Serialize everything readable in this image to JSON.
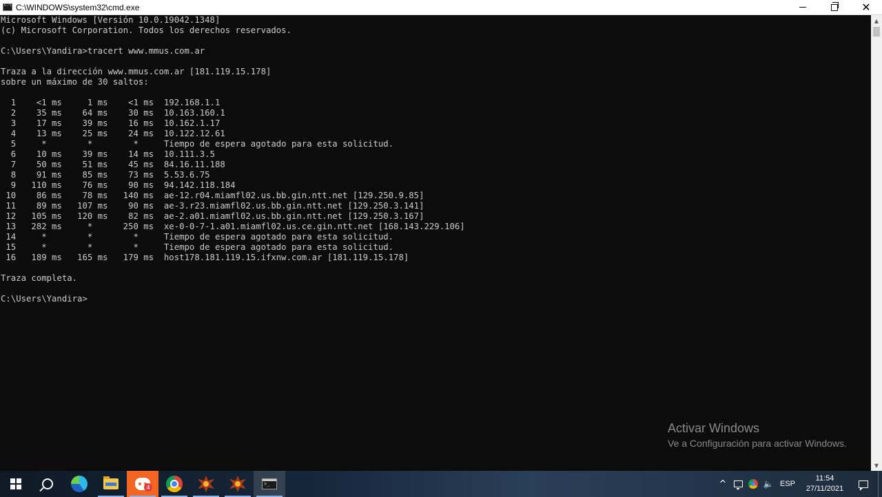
{
  "window": {
    "title": "C:\\WINDOWS\\system32\\cmd.exe",
    "icon": "cmd-icon"
  },
  "console": {
    "lines": [
      "Microsoft Windows [Versión 10.0.19042.1348]",
      "(c) Microsoft Corporation. Todos los derechos reservados.",
      "",
      "C:\\Users\\Yandira>tracert www.mmus.com.ar",
      "",
      "Traza a la dirección www.mmus.com.ar [181.119.15.178]",
      "sobre un máximo de 30 saltos:",
      "",
      "  1    <1 ms     1 ms    <1 ms  192.168.1.1",
      "  2    35 ms    64 ms    30 ms  10.163.160.1",
      "  3    17 ms    39 ms    16 ms  10.162.1.17",
      "  4    13 ms    25 ms    24 ms  10.122.12.61",
      "  5     *        *        *     Tiempo de espera agotado para esta solicitud.",
      "  6    10 ms    39 ms    14 ms  10.111.3.5",
      "  7    50 ms    51 ms    45 ms  84.16.11.188",
      "  8    91 ms    85 ms    73 ms  5.53.6.75",
      "  9   110 ms    76 ms    90 ms  94.142.118.184",
      " 10    86 ms    78 ms   140 ms  ae-12.r04.miamfl02.us.bb.gin.ntt.net [129.250.9.85]",
      " 11    89 ms   107 ms    90 ms  ae-3.r23.miamfl02.us.bb.gin.ntt.net [129.250.3.141]",
      " 12   105 ms   120 ms    82 ms  ae-2.a01.miamfl02.us.bb.gin.ntt.net [129.250.3.167]",
      " 13   282 ms     *      250 ms  xe-0-0-7-1.a01.miamfl02.us.ce.gin.ntt.net [168.143.229.106]",
      " 14     *        *        *     Tiempo de espera agotado para esta solicitud.",
      " 15     *        *        *     Tiempo de espera agotado para esta solicitud.",
      " 16   189 ms   165 ms   179 ms  host178.181.119.15.ifxnw.com.ar [181.119.15.178]",
      "",
      "Traza completa.",
      "",
      "C:\\Users\\Yandira>"
    ]
  },
  "watermark": {
    "title": "Activar Windows",
    "subtitle": "Ve a Configuración para activar Windows."
  },
  "taskbar": {
    "apps": [
      {
        "name": "start",
        "icon": "windows-logo-icon"
      },
      {
        "name": "search",
        "icon": "search-icon"
      },
      {
        "name": "edge",
        "icon": "edge-icon"
      },
      {
        "name": "file-explorer",
        "icon": "folder-icon"
      },
      {
        "name": "discord",
        "icon": "discord-icon",
        "badge": "4"
      },
      {
        "name": "chrome",
        "icon": "chrome-icon"
      },
      {
        "name": "game-1",
        "icon": "game-icon"
      },
      {
        "name": "game-2",
        "icon": "game-icon"
      },
      {
        "name": "cmd",
        "icon": "cmd-icon"
      }
    ],
    "tray": {
      "language": "ESP",
      "time": "11:54",
      "date": "27/11/2021"
    }
  },
  "colors": {
    "console_bg": "#0c0c0c",
    "console_fg": "#cccccc",
    "discord_bg": "#f26522"
  }
}
